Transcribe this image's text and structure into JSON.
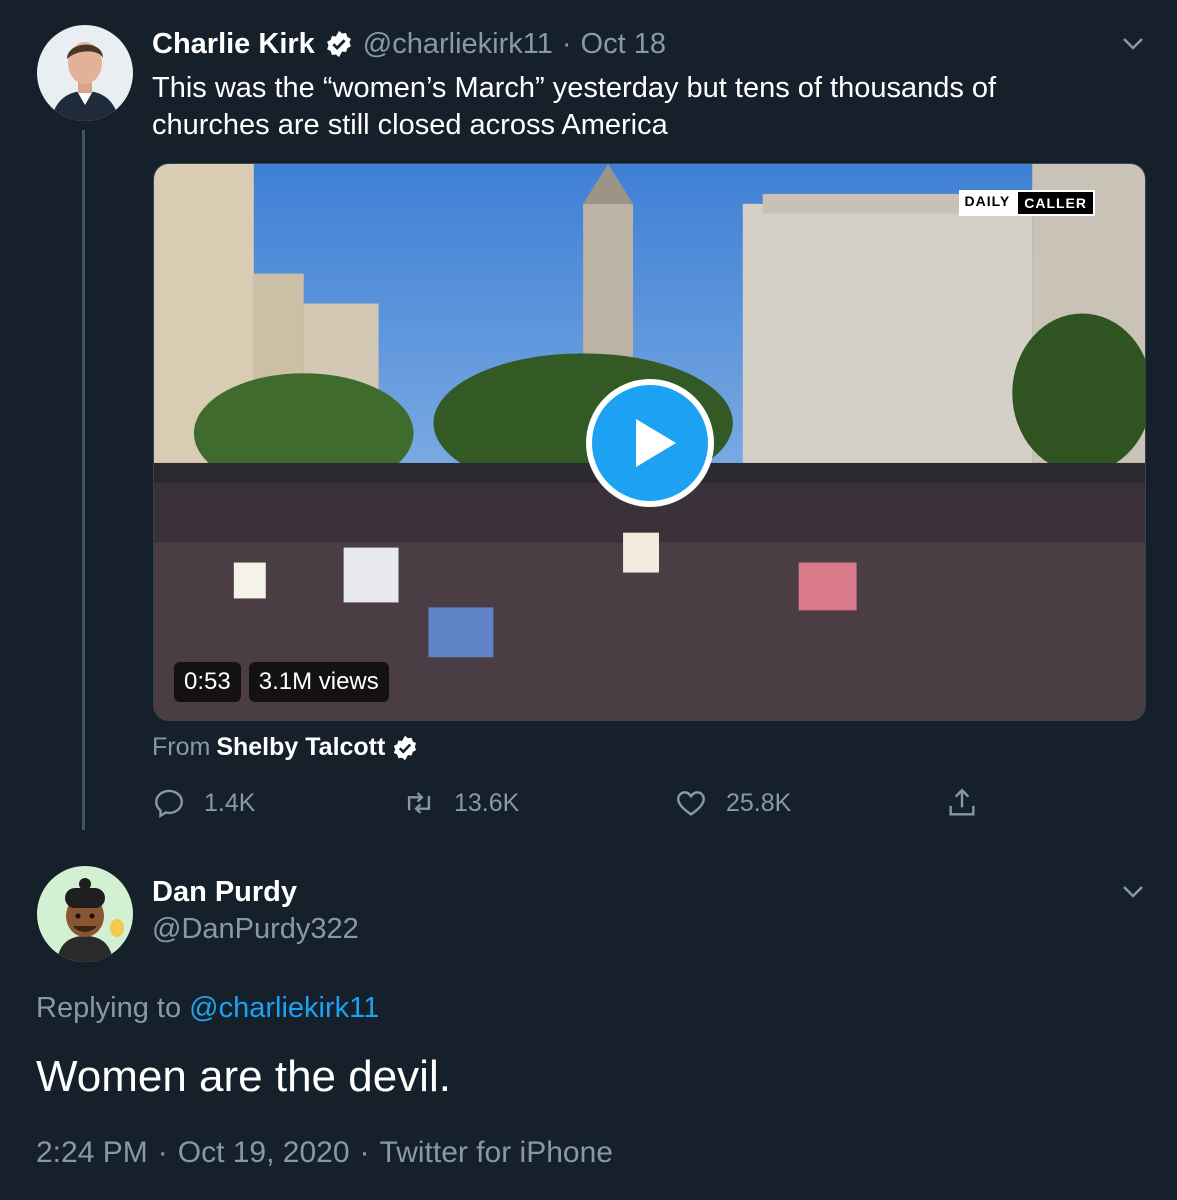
{
  "colors": {
    "background": "#15202b",
    "accent": "#1da1f2",
    "secondary_text": "#8899a6",
    "divider": "#38444d"
  },
  "tweet1": {
    "author_name": "Charlie Kirk",
    "handle": "@charliekirk11",
    "separator": "·",
    "date": "Oct 18",
    "text": "This was the “women’s March” yesterday but tens of thousands of churches are still closed across America",
    "media": {
      "watermark_left": "DAILY",
      "watermark_right": "CALLER",
      "duration": "0:53",
      "views": "3.1M views",
      "play_icon": "play-icon"
    },
    "attribution": {
      "prefix": "From",
      "source": "Shelby Talcott"
    },
    "actions": {
      "reply_count": "1.4K",
      "retweet_count": "13.6K",
      "like_count": "25.8K"
    }
  },
  "tweet2": {
    "author_name": "Dan Purdy",
    "handle": "@DanPurdy322",
    "replying_prefix": "Replying to",
    "replying_to": "@charliekirk11",
    "text": "Women are the devil.",
    "time": "2:24 PM",
    "separator1": "·",
    "date": "Oct 19, 2020",
    "separator2": "·",
    "client": "Twitter for iPhone"
  }
}
